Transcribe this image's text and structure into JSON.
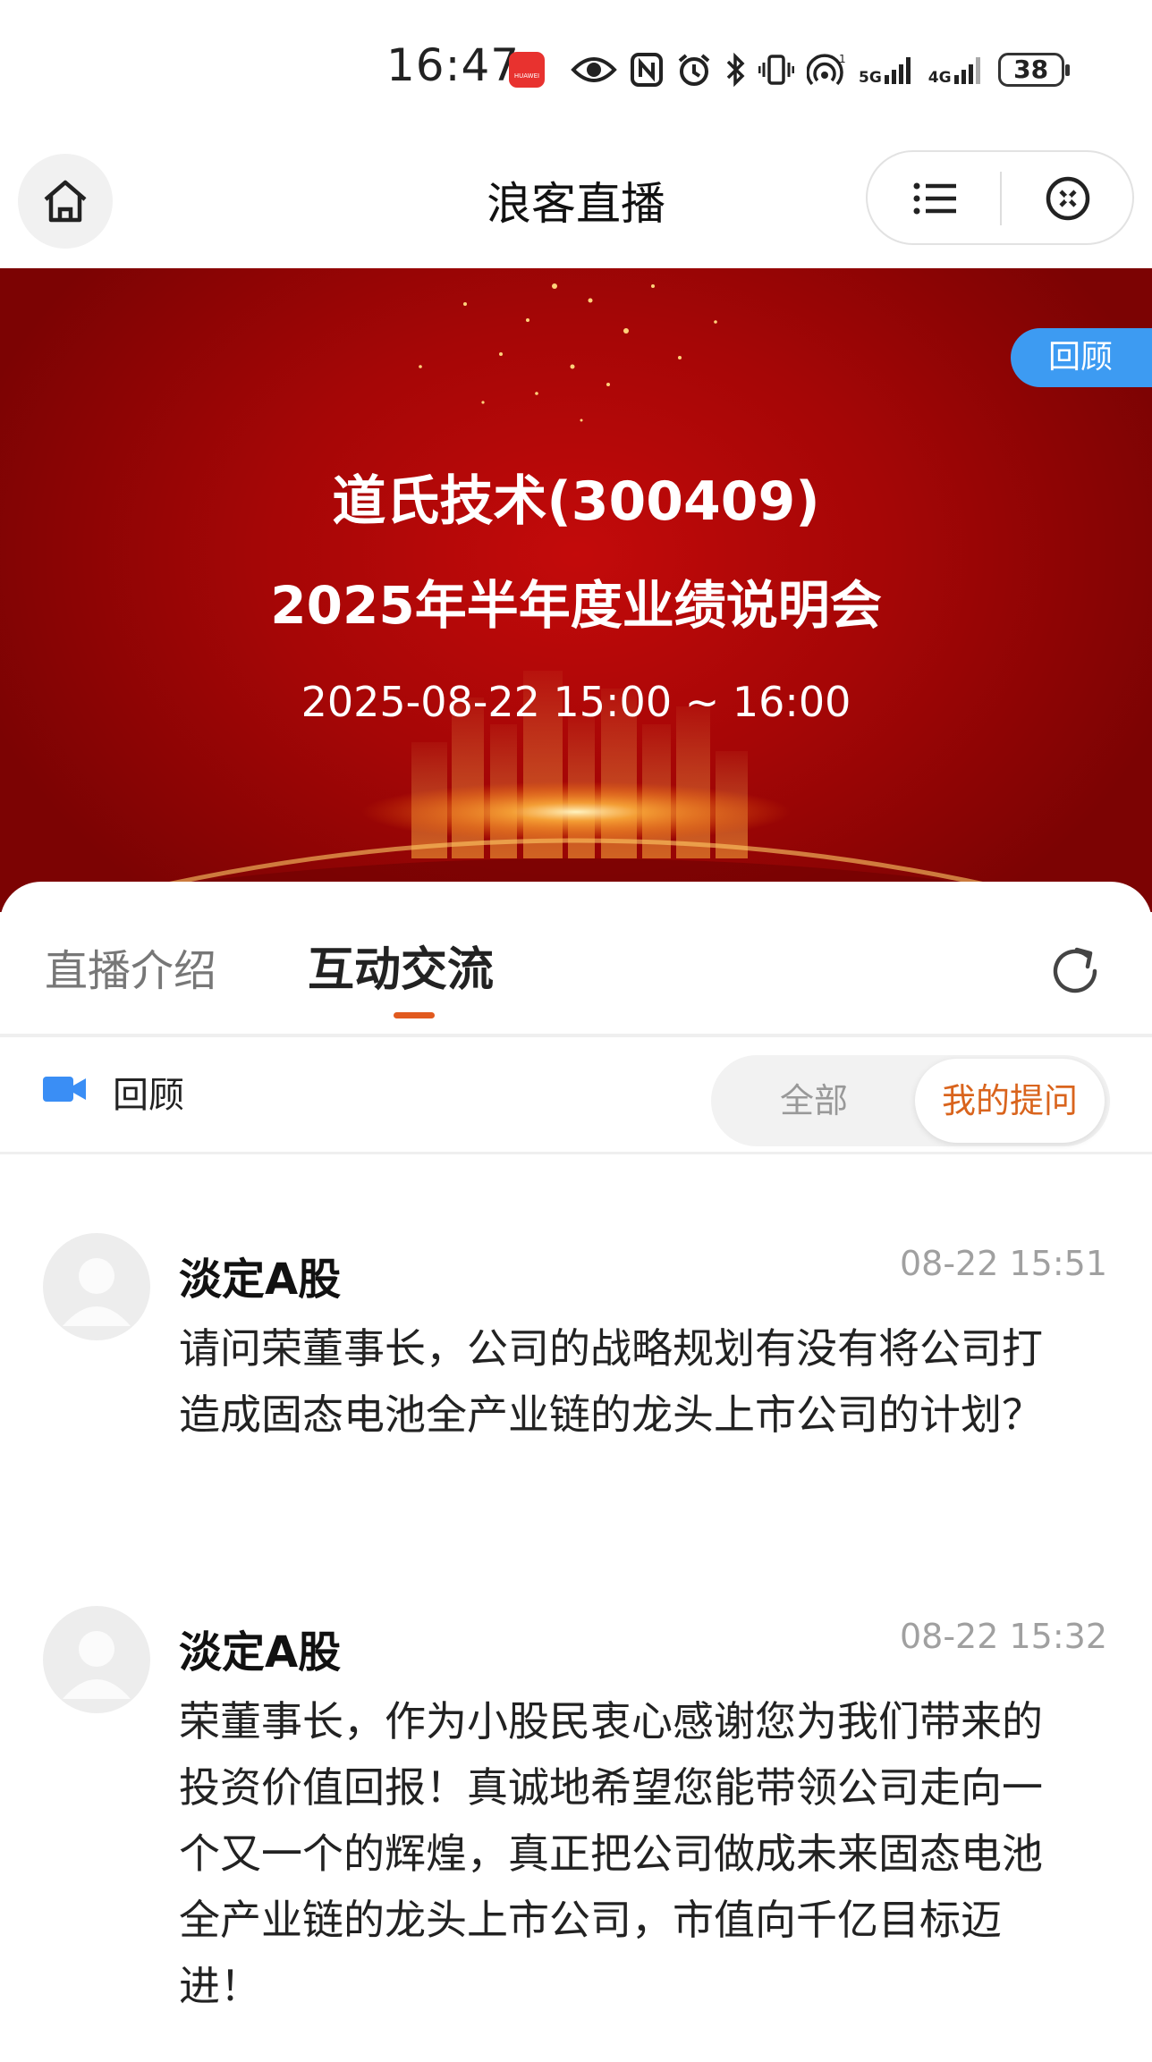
{
  "status_bar": {
    "time": "16:47",
    "app_badge": "HUAWEI",
    "network_1": "5G",
    "network_2": "4G",
    "battery": "38",
    "icons": [
      "eye-icon",
      "nfc-icon",
      "alarm-icon",
      "bluetooth-icon",
      "vibrate-icon",
      "hotspot-icon",
      "signal-icon",
      "battery-icon"
    ]
  },
  "nav": {
    "title": "浪客直播",
    "icons": [
      "home-icon",
      "menu-icon",
      "close-icon"
    ]
  },
  "banner": {
    "badge": "回顾",
    "line1": "道氏技术(300409)",
    "line2": "2025年半年度业绩说明会",
    "date": "2025-08-22 15:00 ~ 16:00",
    "colors": {
      "background": "#a50606",
      "badge": "#3d9bf2"
    }
  },
  "tabs": {
    "intro": "直播介绍",
    "interact": "互动交流",
    "active": "互动交流",
    "accent": "#e15a1f"
  },
  "replay": {
    "label": "回顾"
  },
  "filter": {
    "all": "全部",
    "mine": "我的提问",
    "selected": "我的提问"
  },
  "posts": [
    {
      "user": "淡定A股",
      "time": "08-22 15:51",
      "text": "请问荣董事长，公司的战略规划有没有将公司打造成固态电池全产业链的龙头上市公司的计划？"
    },
    {
      "user": "淡定A股",
      "time": "08-22 15:32",
      "text": "荣董事长，作为小股民衷心感谢您为我们带来的投资价值回报！真诚地希望您能带领公司走向一个又一个的辉煌，真正把公司做成未来固态电池全产业链的龙头上市公司，市值向千亿目标迈进！"
    }
  ]
}
